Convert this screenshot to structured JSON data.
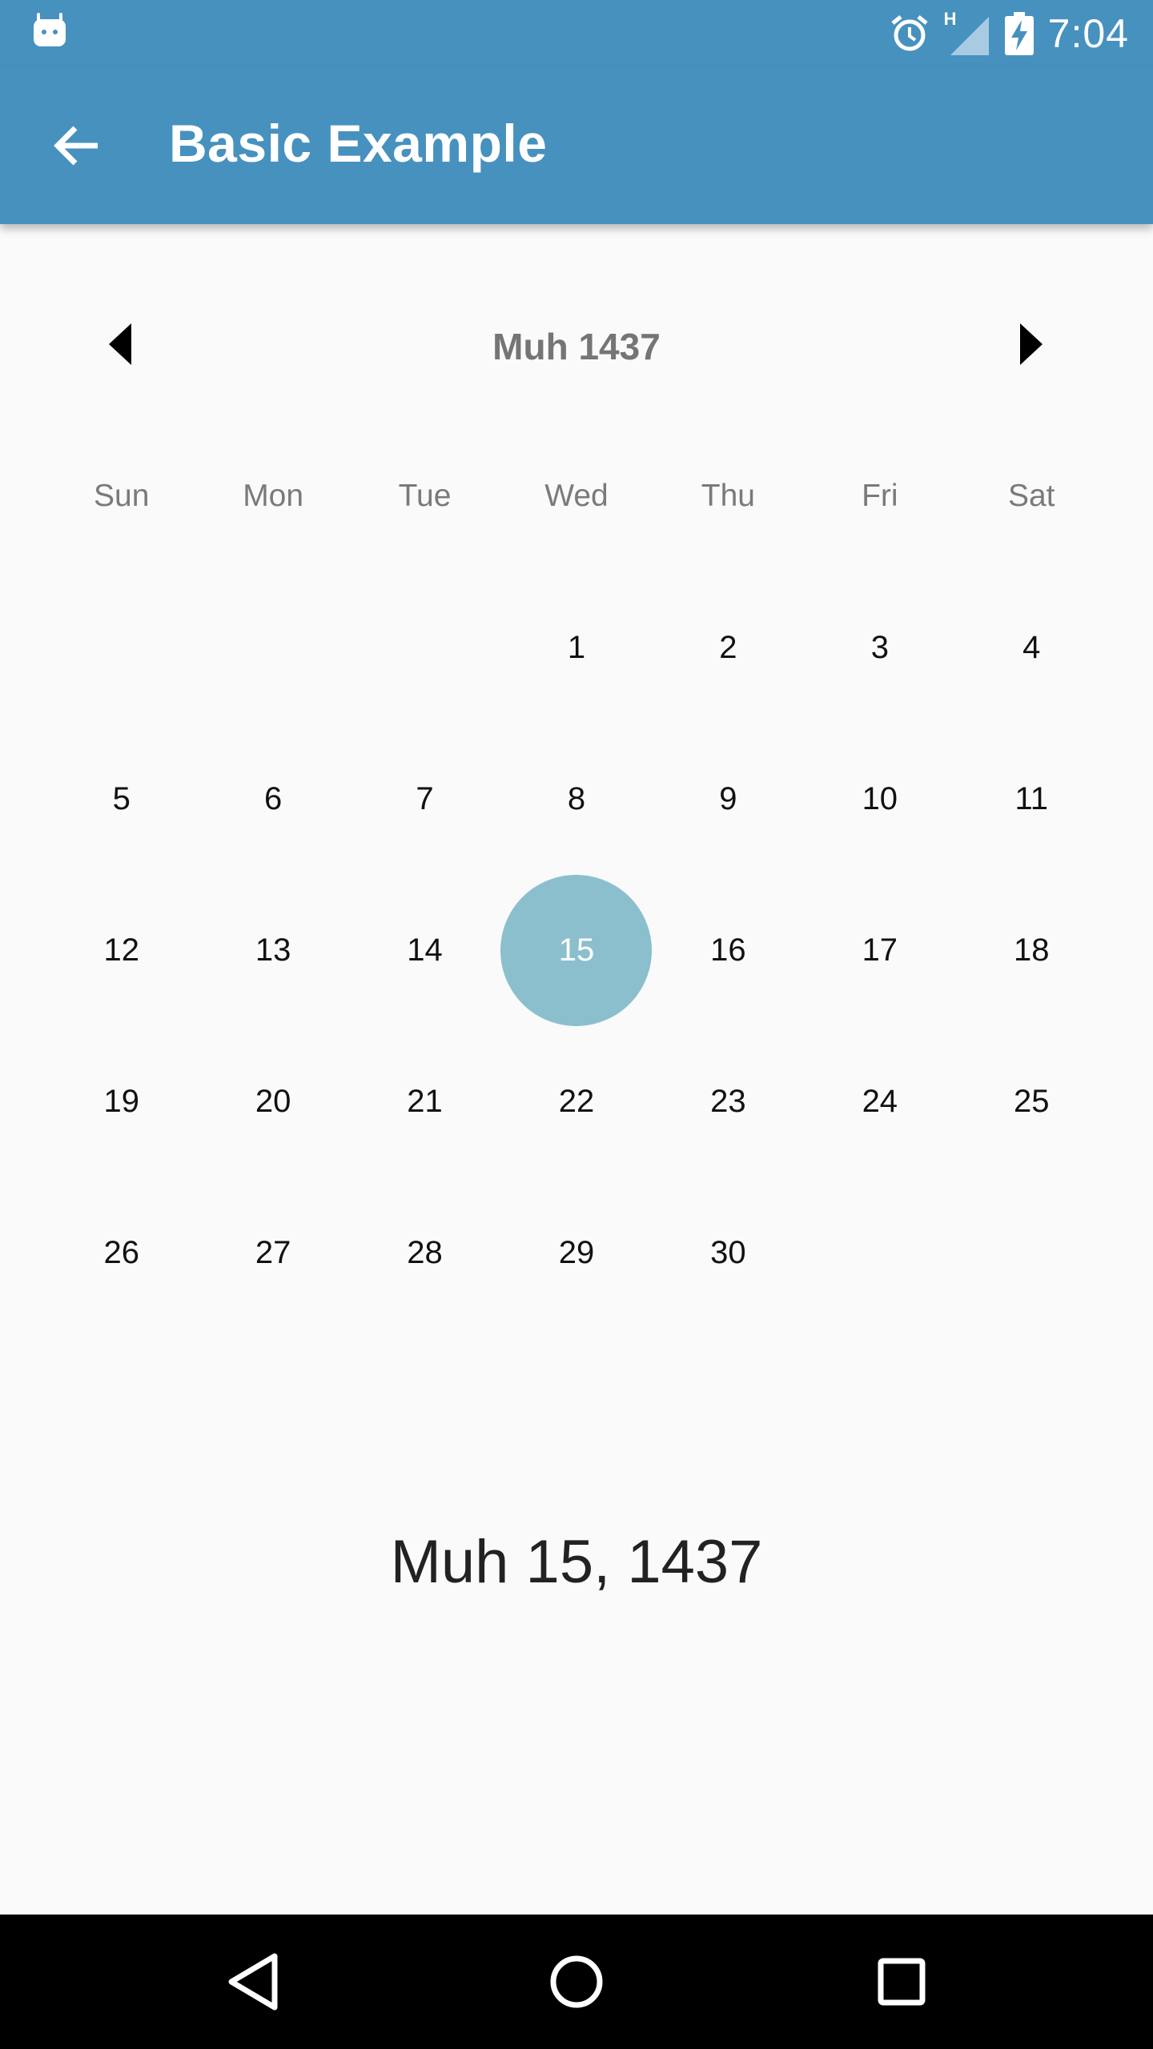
{
  "status_bar": {
    "time": "7:04",
    "network_label": "H",
    "icons": [
      "android-icon",
      "alarm-icon",
      "signal-icon",
      "battery-charging-icon"
    ]
  },
  "app_bar": {
    "title": "Basic Example",
    "back_icon": "arrow-back-icon"
  },
  "calendar": {
    "month_title": "Muh 1437",
    "prev_icon": "triangle-left-icon",
    "next_icon": "triangle-right-icon",
    "weekdays": [
      "Sun",
      "Mon",
      "Tue",
      "Wed",
      "Thu",
      "Fri",
      "Sat"
    ],
    "days": [
      "",
      "",
      "",
      "1",
      "2",
      "3",
      "4",
      "5",
      "6",
      "7",
      "8",
      "9",
      "10",
      "11",
      "12",
      "13",
      "14",
      "15",
      "16",
      "17",
      "18",
      "19",
      "20",
      "21",
      "22",
      "23",
      "24",
      "25",
      "26",
      "27",
      "28",
      "29",
      "30",
      "",
      ""
    ],
    "selected_day": "15"
  },
  "selected_date_text": "Muh 15, 1437",
  "colors": {
    "primary": "#4791bf",
    "selection": "#8bbfce",
    "background": "#fafafa"
  },
  "nav_bar": {
    "icons": [
      "nav-back-icon",
      "nav-home-icon",
      "nav-recents-icon"
    ]
  }
}
